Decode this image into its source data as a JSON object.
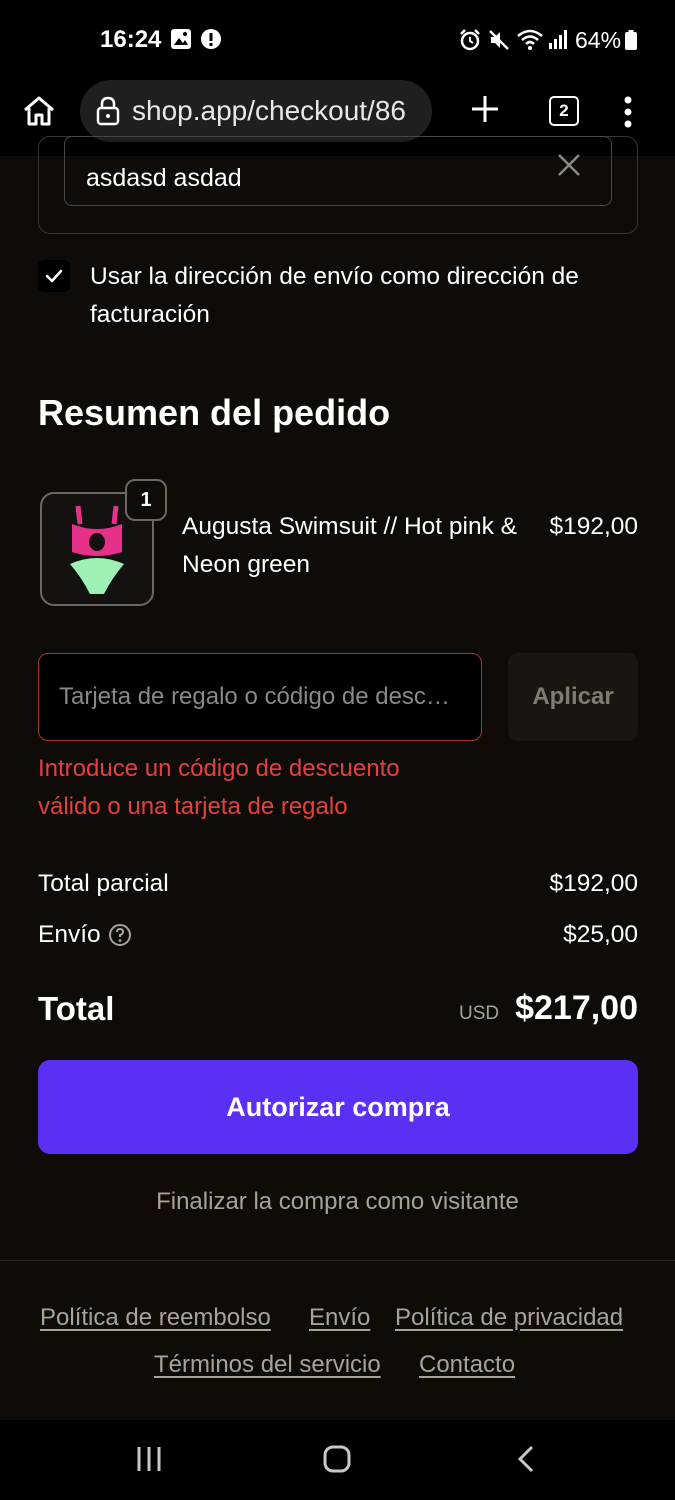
{
  "status_bar": {
    "time": "16:24",
    "battery": "64%"
  },
  "browser": {
    "url": "shop.app/checkout/86",
    "tab_count": "2"
  },
  "shipping_address": {
    "value": "asdasd asdad"
  },
  "billing": {
    "checkbox_label": "Usar la dirección de envío como dirección de facturación",
    "checked": true
  },
  "summary": {
    "title": "Resumen del pedido",
    "item": {
      "name": "Augusta Swimsuit // Hot pink & Neon green",
      "price": "$192,00",
      "quantity": "1"
    }
  },
  "discount": {
    "placeholder": "Tarjeta de regalo o código de desc…",
    "apply_label": "Aplicar",
    "error": "Introduce un código de descuento válido o una tarjeta de regalo"
  },
  "totals": {
    "subtotal_label": "Total parcial",
    "subtotal_value": "$192,00",
    "shipping_label": "Envío",
    "shipping_value": "$25,00",
    "total_label": "Total",
    "currency": "USD",
    "total_value": "$217,00"
  },
  "actions": {
    "authorize_label": "Autorizar compra",
    "guest_label": "Finalizar la compra como visitante"
  },
  "footer": {
    "links": [
      "Política de reembolso",
      "Envío",
      "Política de privacidad",
      "Términos del servicio",
      "Contacto"
    ]
  },
  "colors": {
    "accent": "#5a31f4",
    "error": "#e5413c",
    "background": "#0f0b08"
  }
}
